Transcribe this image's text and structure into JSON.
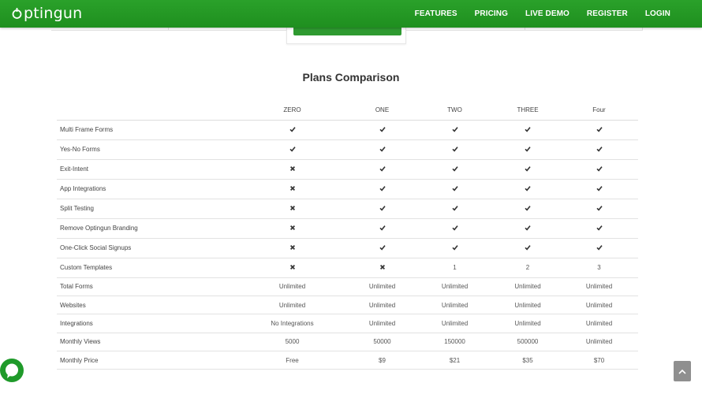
{
  "brand": {
    "name": "Optingun",
    "prefix_letter": "O",
    "rest": "ptingun"
  },
  "nav": {
    "items": [
      {
        "label": "FEATURES"
      },
      {
        "label": "PRICING"
      },
      {
        "label": "LIVE DEMO"
      },
      {
        "label": "REGISTER"
      },
      {
        "label": "LOGIN"
      }
    ]
  },
  "section": {
    "title": "Plans Comparison"
  },
  "table": {
    "columns": [
      "ZERO",
      "ONE",
      "TWO",
      "THREE",
      "Four"
    ],
    "rows": [
      {
        "feature": "Multi Frame Forms",
        "cells": [
          "check",
          "check",
          "check",
          "check",
          "check"
        ]
      },
      {
        "feature": "Yes-No Forms",
        "cells": [
          "check",
          "check",
          "check",
          "check",
          "check"
        ]
      },
      {
        "feature": "Exit-Intent",
        "cells": [
          "cross",
          "check",
          "check",
          "check",
          "check"
        ]
      },
      {
        "feature": "App Integrations",
        "cells": [
          "cross",
          "check",
          "check",
          "check",
          "check"
        ]
      },
      {
        "feature": "Split Testing",
        "cells": [
          "cross",
          "check",
          "check",
          "check",
          "check"
        ]
      },
      {
        "feature": "Remove Optingun Branding",
        "cells": [
          "cross",
          "check",
          "check",
          "check",
          "check"
        ]
      },
      {
        "feature": "One-Click Social Signups",
        "cells": [
          "cross",
          "check",
          "check",
          "check",
          "check"
        ]
      },
      {
        "feature": "Custom Templates",
        "cells": [
          "cross",
          "cross",
          "1",
          "2",
          "3"
        ]
      },
      {
        "feature": "Total Forms",
        "cells": [
          "Unlimited",
          "Unlimited",
          "Unlimited",
          "Unlimited",
          "Unlimited"
        ]
      },
      {
        "feature": "Websites",
        "cells": [
          "Unlimited",
          "Unlimited",
          "Unlimited",
          "Unlimited",
          "Unlimited"
        ]
      },
      {
        "feature": "Integrations",
        "cells": [
          "No Integrations",
          "Unlimited",
          "Unlimited",
          "Unlimited",
          "Unlimited"
        ]
      },
      {
        "feature": "Monthly Views",
        "cells": [
          "5000",
          "50000",
          "150000",
          "500000",
          "Unlimited"
        ]
      },
      {
        "feature": "Monthly Price",
        "cells": [
          "Free",
          "$9",
          "$21",
          "$35",
          "$70"
        ]
      }
    ]
  },
  "icons": {
    "check": "check-icon",
    "cross": "cross-icon",
    "chat": "chat-icon",
    "scroll_top": "chevron-up-icon"
  },
  "colors": {
    "brand_green": "#2aa12a",
    "button_green": "#2e9a30",
    "chat_green": "#1f9a2a",
    "scroll_gray": "#8f8f8f"
  }
}
